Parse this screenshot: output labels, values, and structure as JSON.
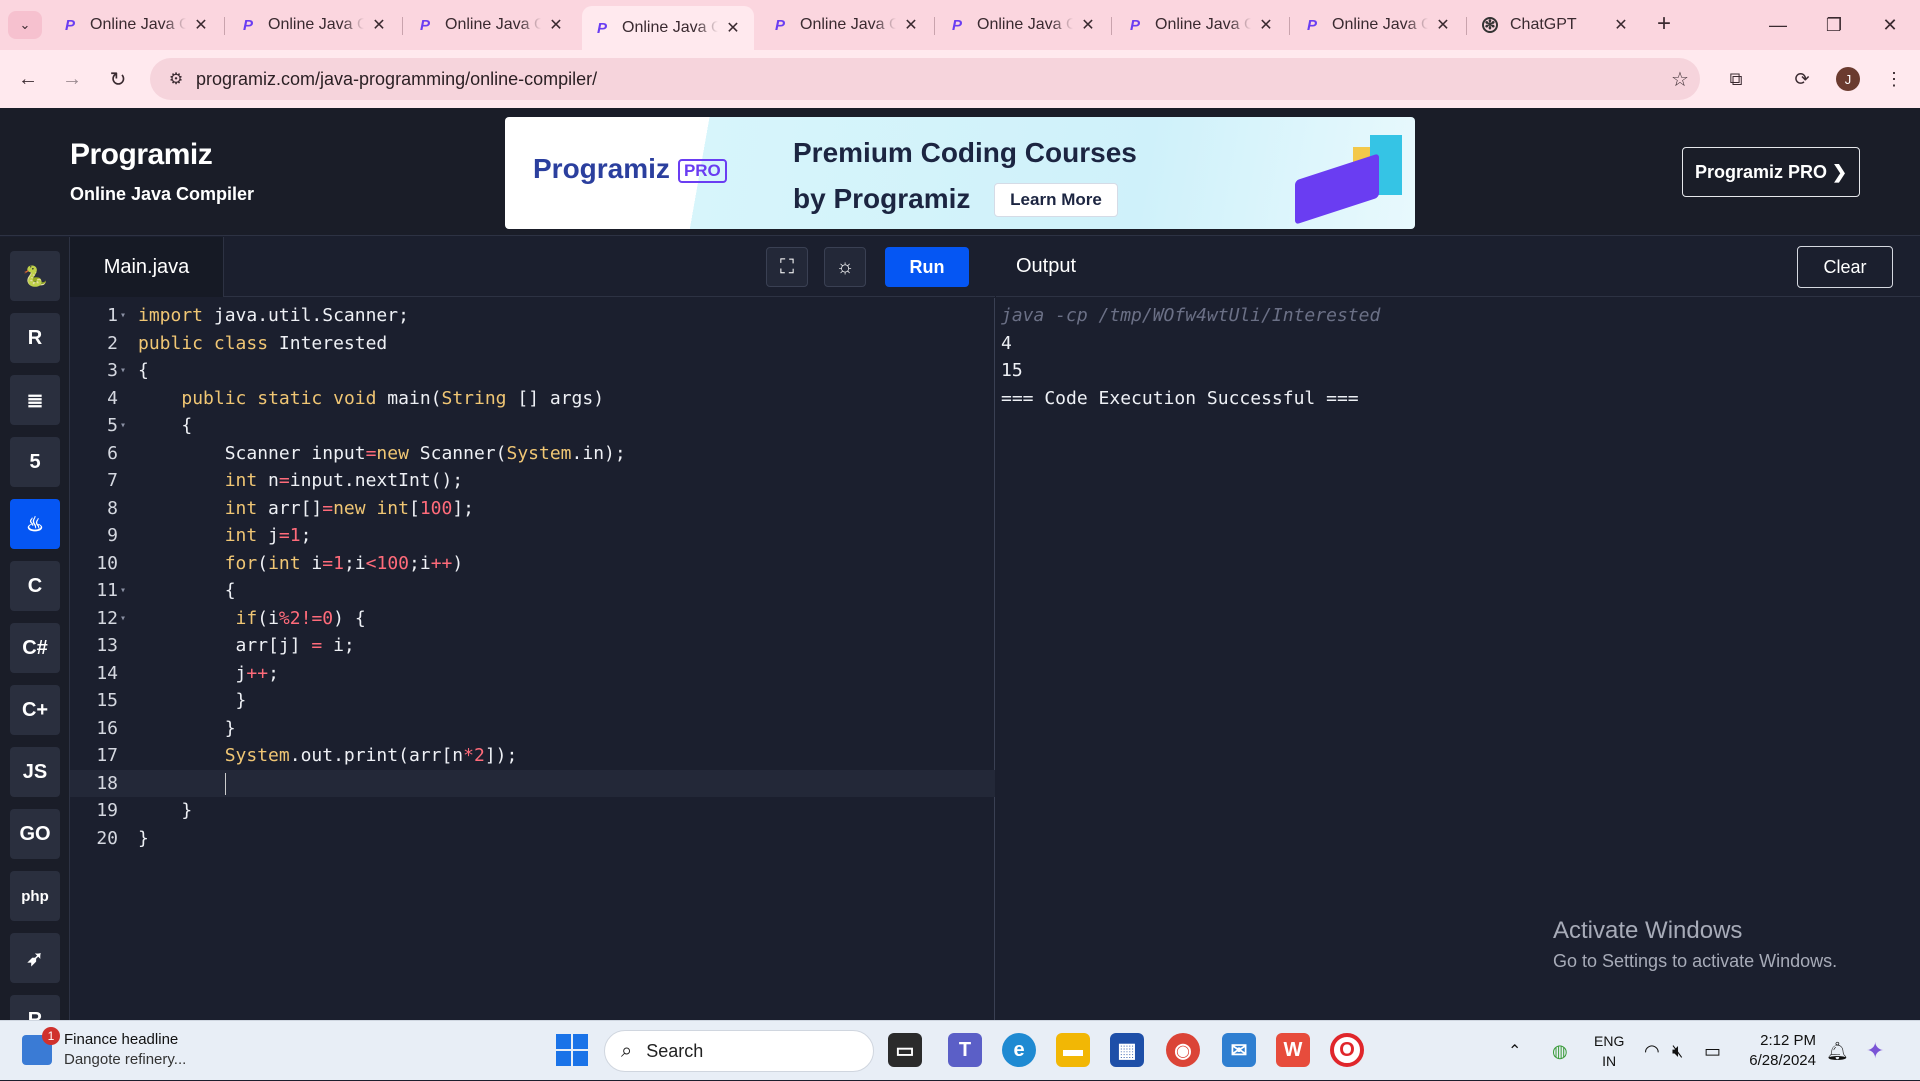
{
  "browser": {
    "tabs": [
      {
        "title": "Online Java Compiler",
        "icon": "programiz-favicon",
        "active": false
      },
      {
        "title": "Online Java Compiler",
        "icon": "programiz-favicon",
        "active": false
      },
      {
        "title": "Online Java Compiler",
        "icon": "programiz-favicon",
        "active": false
      },
      {
        "title": "Online Java Compiler",
        "icon": "programiz-favicon",
        "active": true
      },
      {
        "title": "Online Java Compiler",
        "icon": "programiz-favicon",
        "active": false
      },
      {
        "title": "Online Java Compiler",
        "icon": "programiz-favicon",
        "active": false
      },
      {
        "title": "Online Java Compiler",
        "icon": "programiz-favicon",
        "active": false
      },
      {
        "title": "Online Java Compiler",
        "icon": "programiz-favicon",
        "active": false
      },
      {
        "title": "ChatGPT",
        "icon": "chatgpt-favicon",
        "active": false
      }
    ],
    "url": "programiz.com/java-programming/online-compiler/",
    "profile_initial": "J"
  },
  "header": {
    "logo": "Programiz",
    "subtitle": "Online Java Compiler",
    "banner": {
      "brand": "Programiz",
      "brand_badge": "PRO",
      "headline_1": "Premium Coding Courses",
      "headline_2": "by Programiz",
      "cta": "Learn More"
    },
    "pro_button": "Programiz PRO ❯"
  },
  "languages": [
    {
      "name": "python",
      "glyph": "🐍"
    },
    {
      "name": "r",
      "glyph": "R"
    },
    {
      "name": "sql",
      "glyph": "≣"
    },
    {
      "name": "html",
      "glyph": "5"
    },
    {
      "name": "java",
      "glyph": "♨",
      "active": true
    },
    {
      "name": "c",
      "glyph": "C"
    },
    {
      "name": "csharp",
      "glyph": "C#"
    },
    {
      "name": "cpp",
      "glyph": "C+"
    },
    {
      "name": "js",
      "glyph": "JS"
    },
    {
      "name": "go",
      "glyph": "GO"
    },
    {
      "name": "php",
      "glyph": "php"
    },
    {
      "name": "swift",
      "glyph": "➶"
    },
    {
      "name": "rust",
      "glyph": "R"
    }
  ],
  "editor": {
    "file_tab": "Main.java",
    "run_label": "Run",
    "lines": [
      "import java.util.Scanner;",
      "public class Interested",
      "{",
      "    public static void main(String [] args)",
      "    {",
      "        Scanner input=new Scanner(System.in);",
      "        int n=input.nextInt();",
      "        int arr[]=new int[100];",
      "        int j=1;",
      "        for(int i=1;i<100;i++)",
      "        {",
      "         if(i%2!=0) {",
      "         arr[j] = i;",
      "         j++;",
      "         }",
      "        }",
      "        System.out.print(arr[n*2]);",
      "        ",
      "    }",
      "}"
    ],
    "fold_lines": [
      1,
      3,
      5,
      11,
      12
    ],
    "current_line": 18
  },
  "output": {
    "title": "Output",
    "clear_label": "Clear",
    "lines": [
      "java -cp /tmp/WOfw4wtUli/Interested",
      "4",
      "15",
      "=== Code Execution Successful ==="
    ]
  },
  "watermark": {
    "title": "Activate Windows",
    "subtitle": "Go to Settings to activate Windows."
  },
  "taskbar": {
    "news_title": "Finance headline",
    "news_sub": "Dangote refinery...",
    "news_badge": "1",
    "search_placeholder": "Search",
    "lang_1": "ENG",
    "lang_2": "IN",
    "time": "2:12 PM",
    "date": "6/28/2024"
  }
}
